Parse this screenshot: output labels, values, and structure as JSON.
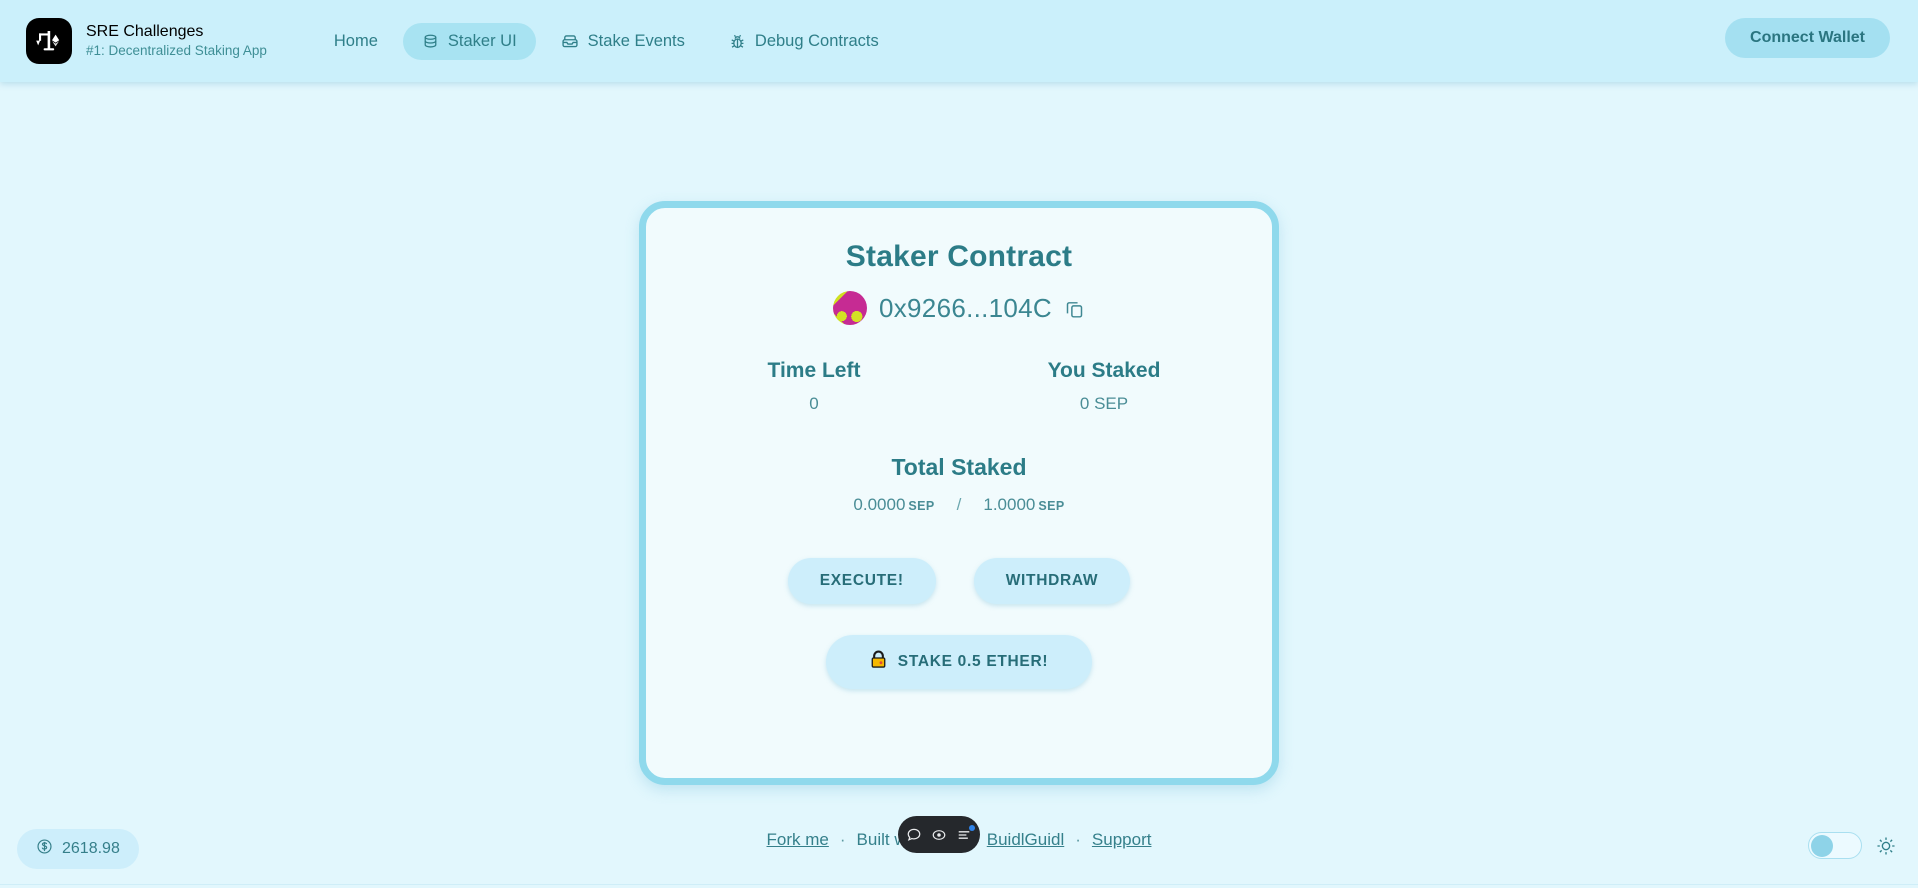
{
  "header": {
    "logo_icon": "scale-ethereum-logo-icon",
    "brand_title": "SRE Challenges",
    "brand_subtitle": "#1: Decentralized Staking App",
    "nav": [
      {
        "label": "Home",
        "icon": "",
        "active": false
      },
      {
        "label": "Staker UI",
        "icon": "database-icon",
        "active": true
      },
      {
        "label": "Stake Events",
        "icon": "inbox-icon",
        "active": false
      },
      {
        "label": "Debug Contracts",
        "icon": "bug-icon",
        "active": false
      }
    ],
    "connect_wallet_label": "Connect Wallet"
  },
  "card": {
    "title": "Staker Contract",
    "avatar_icon": "blockie-avatar",
    "address": "0x9266...104C",
    "copy_icon": "copy-icon",
    "stats": [
      {
        "label": "Time Left",
        "value": "0"
      },
      {
        "label": "You Staked",
        "value": "0 SEP"
      }
    ],
    "total_label": "Total Staked",
    "total_current": "0.0000",
    "total_current_unit": "SEP",
    "total_separator": "/",
    "total_threshold": "1.0000",
    "total_threshold_unit": "SEP",
    "buttons": {
      "execute_label": "EXECUTE!",
      "withdraw_label": "WITHDRAW",
      "stake_icon": "lock-icon",
      "stake_label": "STAKE 0.5 ETHER!"
    }
  },
  "footer": {
    "fork_label": "Fork me",
    "dot1": "·",
    "built_with": "Built with",
    "heart_icon": "heart-icon",
    "at_label": "at",
    "buidlguidl_label": "BuidlGuidl",
    "dot2": "·",
    "support_label": "Support"
  },
  "status_bar": {
    "price_icon": "dollar-circle-icon",
    "price_value": "2618.98",
    "theme_toggle_state": "off",
    "sun_icon": "sun-icon"
  },
  "floating_toolbar": {
    "icons": [
      "chat-bubble-icon",
      "eye-target-icon",
      "list-menu-icon"
    ],
    "badge": true
  },
  "colors": {
    "page_bg": "#e2f7fd",
    "header_bg": "#cbf0fb",
    "accent": "#2c7c87",
    "card_border": "#8fd9ec",
    "card_bg": "#f1fbfd",
    "button_bg": "#cdeefb",
    "active_nav_bg": "#a8e3f2"
  }
}
